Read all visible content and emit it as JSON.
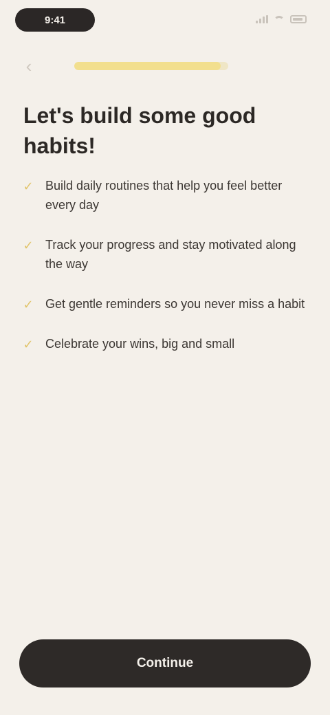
{
  "status_bar": {
    "time": "9:41",
    "icons": [
      "signal-icon",
      "wifi-icon",
      "battery-icon"
    ]
  },
  "nav": {
    "back_icon": "chevron-left-icon",
    "progress_fraction": 0.95
  },
  "title": "Let's build some good habits!",
  "benefits": [
    {
      "icon": "check-icon",
      "text": "Build daily routines that help you feel better every day"
    },
    {
      "icon": "check-icon",
      "text": "Track your progress and stay motivated along the way"
    },
    {
      "icon": "check-icon",
      "text": "Get gentle reminders so you never miss a habit"
    },
    {
      "icon": "check-icon",
      "text": "Celebrate your wins, big and small"
    }
  ],
  "cta": {
    "label": "Continue"
  },
  "colors": {
    "background": "#f4f0ea",
    "accent": "#f2df8e",
    "check": "#e1c46a",
    "button": "#2e2a28"
  }
}
